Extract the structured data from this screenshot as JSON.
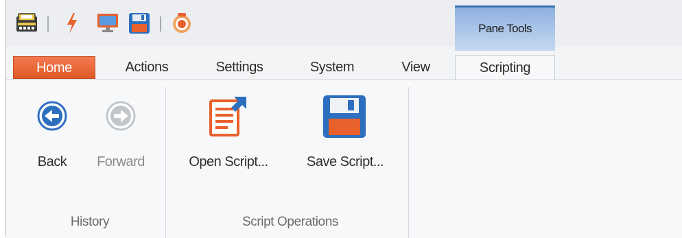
{
  "contextual_group": {
    "title": "Pane Tools"
  },
  "tabs": [
    {
      "label": "Home"
    },
    {
      "label": "Actions"
    },
    {
      "label": "Settings"
    },
    {
      "label": "System"
    },
    {
      "label": "View"
    },
    {
      "label": "Scripting"
    }
  ],
  "quick_access": [
    {
      "icon": "toolbox-icon"
    },
    {
      "icon": "lightning-icon"
    },
    {
      "icon": "monitor-icon"
    },
    {
      "icon": "floppy-disk-icon"
    },
    {
      "icon": "record-icon"
    }
  ],
  "ribbon": {
    "groups": [
      {
        "label": "History",
        "buttons": [
          {
            "label": "Back",
            "icon": "arrow-left-icon",
            "enabled": true
          },
          {
            "label": "Forward",
            "icon": "arrow-right-icon",
            "enabled": false
          }
        ]
      },
      {
        "label": "Script Operations",
        "buttons": [
          {
            "label": "Open Script...",
            "icon": "open-script-icon",
            "enabled": true
          },
          {
            "label": "Save Script...",
            "icon": "floppy-disk-icon",
            "enabled": true
          }
        ]
      }
    ]
  },
  "colors": {
    "home_tab": "#e9622f",
    "context_header": "#a9c4ea",
    "accent_blue": "#2c6fbf",
    "accent_orange": "#e8602c"
  }
}
